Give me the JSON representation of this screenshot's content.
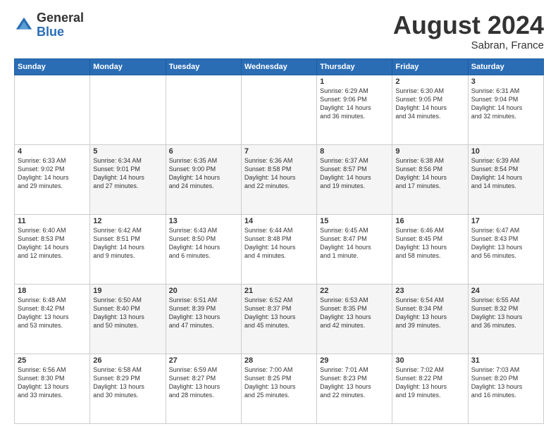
{
  "header": {
    "logo_general": "General",
    "logo_blue": "Blue",
    "month_title": "August 2024",
    "location": "Sabran, France"
  },
  "days_of_week": [
    "Sunday",
    "Monday",
    "Tuesday",
    "Wednesday",
    "Thursday",
    "Friday",
    "Saturday"
  ],
  "weeks": [
    [
      {
        "day": "",
        "info": ""
      },
      {
        "day": "",
        "info": ""
      },
      {
        "day": "",
        "info": ""
      },
      {
        "day": "",
        "info": ""
      },
      {
        "day": "1",
        "info": "Sunrise: 6:29 AM\nSunset: 9:06 PM\nDaylight: 14 hours\nand 36 minutes."
      },
      {
        "day": "2",
        "info": "Sunrise: 6:30 AM\nSunset: 9:05 PM\nDaylight: 14 hours\nand 34 minutes."
      },
      {
        "day": "3",
        "info": "Sunrise: 6:31 AM\nSunset: 9:04 PM\nDaylight: 14 hours\nand 32 minutes."
      }
    ],
    [
      {
        "day": "4",
        "info": "Sunrise: 6:33 AM\nSunset: 9:02 PM\nDaylight: 14 hours\nand 29 minutes."
      },
      {
        "day": "5",
        "info": "Sunrise: 6:34 AM\nSunset: 9:01 PM\nDaylight: 14 hours\nand 27 minutes."
      },
      {
        "day": "6",
        "info": "Sunrise: 6:35 AM\nSunset: 9:00 PM\nDaylight: 14 hours\nand 24 minutes."
      },
      {
        "day": "7",
        "info": "Sunrise: 6:36 AM\nSunset: 8:58 PM\nDaylight: 14 hours\nand 22 minutes."
      },
      {
        "day": "8",
        "info": "Sunrise: 6:37 AM\nSunset: 8:57 PM\nDaylight: 14 hours\nand 19 minutes."
      },
      {
        "day": "9",
        "info": "Sunrise: 6:38 AM\nSunset: 8:56 PM\nDaylight: 14 hours\nand 17 minutes."
      },
      {
        "day": "10",
        "info": "Sunrise: 6:39 AM\nSunset: 8:54 PM\nDaylight: 14 hours\nand 14 minutes."
      }
    ],
    [
      {
        "day": "11",
        "info": "Sunrise: 6:40 AM\nSunset: 8:53 PM\nDaylight: 14 hours\nand 12 minutes."
      },
      {
        "day": "12",
        "info": "Sunrise: 6:42 AM\nSunset: 8:51 PM\nDaylight: 14 hours\nand 9 minutes."
      },
      {
        "day": "13",
        "info": "Sunrise: 6:43 AM\nSunset: 8:50 PM\nDaylight: 14 hours\nand 6 minutes."
      },
      {
        "day": "14",
        "info": "Sunrise: 6:44 AM\nSunset: 8:48 PM\nDaylight: 14 hours\nand 4 minutes."
      },
      {
        "day": "15",
        "info": "Sunrise: 6:45 AM\nSunset: 8:47 PM\nDaylight: 14 hours\nand 1 minute."
      },
      {
        "day": "16",
        "info": "Sunrise: 6:46 AM\nSunset: 8:45 PM\nDaylight: 13 hours\nand 58 minutes."
      },
      {
        "day": "17",
        "info": "Sunrise: 6:47 AM\nSunset: 8:43 PM\nDaylight: 13 hours\nand 56 minutes."
      }
    ],
    [
      {
        "day": "18",
        "info": "Sunrise: 6:48 AM\nSunset: 8:42 PM\nDaylight: 13 hours\nand 53 minutes."
      },
      {
        "day": "19",
        "info": "Sunrise: 6:50 AM\nSunset: 8:40 PM\nDaylight: 13 hours\nand 50 minutes."
      },
      {
        "day": "20",
        "info": "Sunrise: 6:51 AM\nSunset: 8:39 PM\nDaylight: 13 hours\nand 47 minutes."
      },
      {
        "day": "21",
        "info": "Sunrise: 6:52 AM\nSunset: 8:37 PM\nDaylight: 13 hours\nand 45 minutes."
      },
      {
        "day": "22",
        "info": "Sunrise: 6:53 AM\nSunset: 8:35 PM\nDaylight: 13 hours\nand 42 minutes."
      },
      {
        "day": "23",
        "info": "Sunrise: 6:54 AM\nSunset: 8:34 PM\nDaylight: 13 hours\nand 39 minutes."
      },
      {
        "day": "24",
        "info": "Sunrise: 6:55 AM\nSunset: 8:32 PM\nDaylight: 13 hours\nand 36 minutes."
      }
    ],
    [
      {
        "day": "25",
        "info": "Sunrise: 6:56 AM\nSunset: 8:30 PM\nDaylight: 13 hours\nand 33 minutes."
      },
      {
        "day": "26",
        "info": "Sunrise: 6:58 AM\nSunset: 8:29 PM\nDaylight: 13 hours\nand 30 minutes."
      },
      {
        "day": "27",
        "info": "Sunrise: 6:59 AM\nSunset: 8:27 PM\nDaylight: 13 hours\nand 28 minutes."
      },
      {
        "day": "28",
        "info": "Sunrise: 7:00 AM\nSunset: 8:25 PM\nDaylight: 13 hours\nand 25 minutes."
      },
      {
        "day": "29",
        "info": "Sunrise: 7:01 AM\nSunset: 8:23 PM\nDaylight: 13 hours\nand 22 minutes."
      },
      {
        "day": "30",
        "info": "Sunrise: 7:02 AM\nSunset: 8:22 PM\nDaylight: 13 hours\nand 19 minutes."
      },
      {
        "day": "31",
        "info": "Sunrise: 7:03 AM\nSunset: 8:20 PM\nDaylight: 13 hours\nand 16 minutes."
      }
    ]
  ]
}
